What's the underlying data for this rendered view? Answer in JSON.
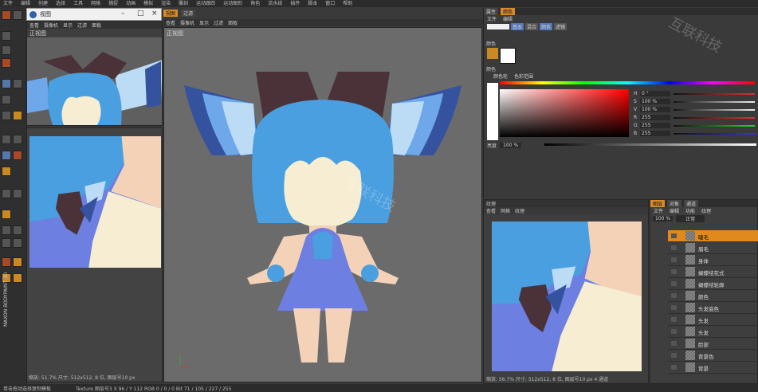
{
  "menu": [
    "文件",
    "编辑",
    "创建",
    "选择",
    "工具",
    "网格",
    "捕捉",
    "动画",
    "模拟",
    "渲染",
    "雕刻",
    "运动跟踪",
    "运动图形",
    "角色",
    "流水线",
    "插件",
    "脚本",
    "窗口",
    "帮助"
  ],
  "floating_window": {
    "title": "视图"
  },
  "small_view": {
    "toolbar": [
      "查看",
      "摄像机",
      "显示",
      "过滤",
      "面板"
    ],
    "label": "正视图"
  },
  "main_view": {
    "tabs": [
      "视图",
      "过滤"
    ],
    "toolbar": [
      "查看",
      "摄像机",
      "显示",
      "过滤",
      "面板"
    ],
    "label": "正视图"
  },
  "right_panel": {
    "tabs": [
      "属性",
      "颜色"
    ],
    "subtabs": [
      "文件",
      "编辑"
    ],
    "modes": [
      "基本",
      "混合",
      "颜色",
      "滤镜"
    ],
    "color_label": "颜色",
    "sub_label": "颜色",
    "options": [
      "颜色轮",
      "色彩范围"
    ],
    "rgb_labels": [
      "H",
      "S",
      "V",
      "R",
      "G",
      "B"
    ],
    "rgb_values": [
      "0 °",
      "100 %",
      "100 %",
      "255",
      "255",
      "255"
    ],
    "brightness_label": "亮度",
    "brightness_value": "100 %"
  },
  "texture_panel": {
    "title": "纹理",
    "toolbar": [
      "查看",
      "网格",
      "纹理"
    ],
    "status": "缩放: 56.7% 尺寸: 512x512, 8 位, 图层号10 px 4 通道"
  },
  "layers_panel": {
    "tabs": [
      "图层",
      "对象",
      "通道"
    ],
    "toolbar": [
      "文件",
      "编辑",
      "功能",
      "纹理"
    ],
    "opacity": "100 %",
    "blend": "正常",
    "items": [
      "睫毛",
      "眉毛",
      "身体",
      "蝴蝶结花式",
      "蝴蝶结轮廓",
      "颜色",
      "头发底色",
      "头发",
      "头发",
      "脸部",
      "背景色",
      "背景"
    ],
    "selected_index": 0
  },
  "small_status": "缩放: 51.7% 尺寸: 512x512, 8 位, 图层号10 px",
  "status_bar": {
    "left": "单击拖动选择复制模板",
    "right": "Texture  图层号3  X 96 / Y 112 RGB 0 / 0 / 0  Bit 71 / 105 / 227 / 255"
  },
  "brand_vertical": "MAXON BODYPAINT 3D",
  "watermark": "互联科技",
  "colors": {
    "hair": "#4a9fe0",
    "skin": "#f7edd2",
    "bow": "#4a3238",
    "wing_dark": "#35529f",
    "wing_mid": "#6fa8ea",
    "wing_light": "#bcdcf6",
    "dress": "#6d7fe0",
    "leg": "#f4d2b8",
    "accent": "#e08a1e"
  }
}
